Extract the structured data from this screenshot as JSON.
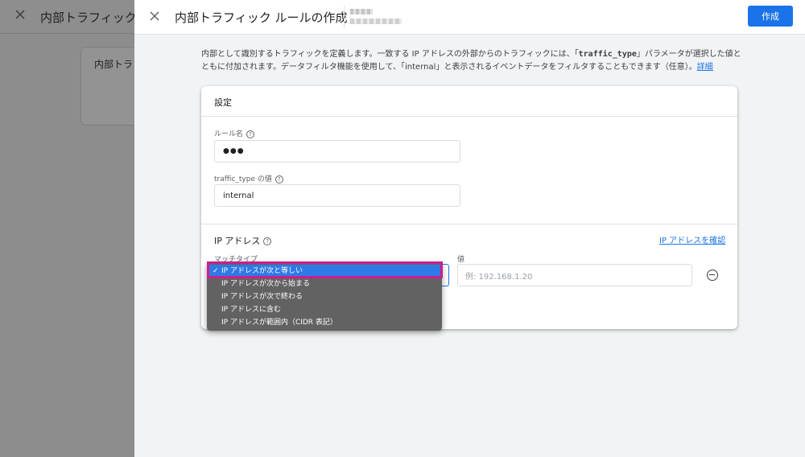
{
  "background": {
    "title": "内部トラフィックの",
    "card_label": "内部トラフ"
  },
  "drawer": {
    "title": "内部トラフィック ルールの作成",
    "create_button": "作成",
    "description_part1": "内部として識別するトラフィックを定義します。一致する IP アドレスの外部からのトラフィックには、「",
    "description_code": "traffic_type",
    "description_part2": "」パラメータが選択した値とともに付加されます。データフィルタ機能を使用して、「internal」と表示されるイベントデータをフィルタすることもできます（任意）。",
    "description_link": "詳細"
  },
  "settings": {
    "header": "設定",
    "rule_name_label": "ルール名",
    "rule_name_value": "●●●",
    "traffic_type_label": "traffic_type の値",
    "traffic_type_value": "internal",
    "ip_section_label": "IP アドレス",
    "ip_check_link": "IP アドレスを確認",
    "match_type_label": "マッチタイプ",
    "value_label": "値",
    "value_placeholder": "例: 192.168.1.20"
  },
  "dropdown": {
    "options": [
      "IP アドレスが次と等しい",
      "IP アドレスが次から始まる",
      "IP アドレスが次で終わる",
      "IP アドレスに含む",
      "IP アドレスが範囲内（CIDR 表記）"
    ],
    "selected_index": 0,
    "check_mark": "✓"
  },
  "colors": {
    "accent": "#1a73e8",
    "highlight_border": "#cc1f8a",
    "dropdown_bg": "#626262",
    "dropdown_selected": "#2f79e6"
  }
}
